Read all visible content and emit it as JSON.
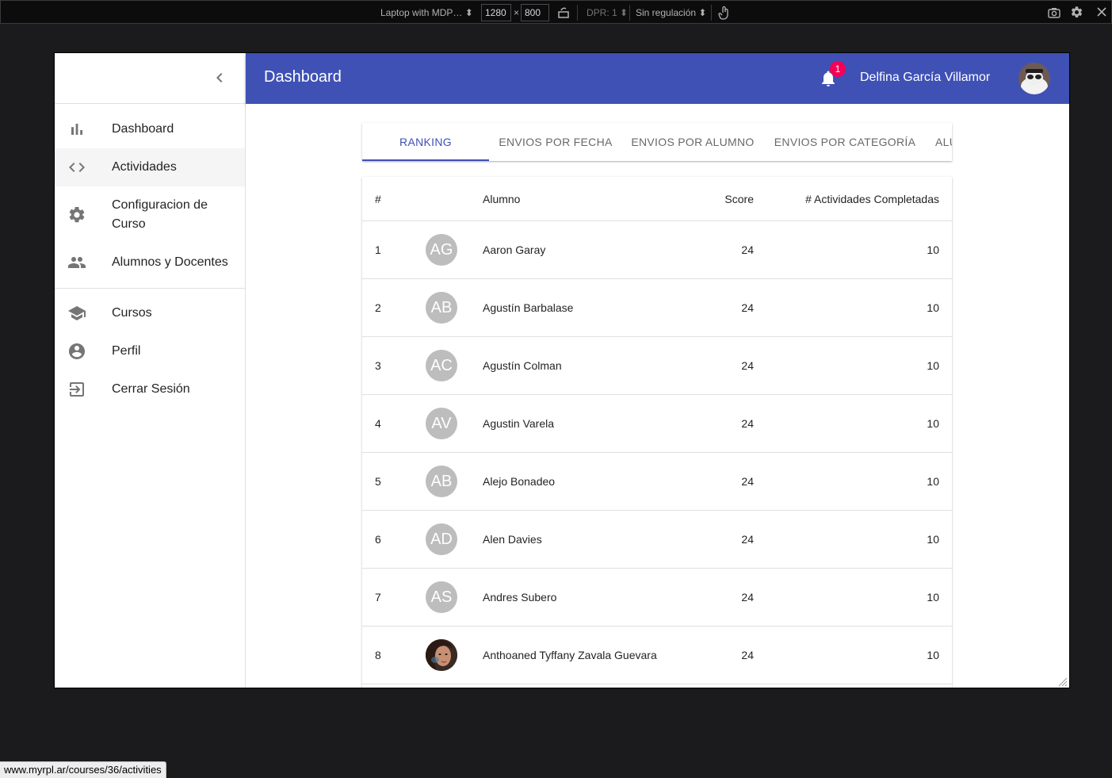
{
  "devtools": {
    "device": "Laptop with MDP…",
    "width": "1280",
    "times": "×",
    "height": "800",
    "dpr": "DPR: 1",
    "throttling": "Sin regulación"
  },
  "sidebar": {
    "primary": [
      {
        "label": "Dashboard",
        "icon": "bar-chart-icon",
        "active": false
      },
      {
        "label": "Actividades",
        "icon": "code-icon",
        "active": true
      },
      {
        "label": "Configuracion de Curso",
        "icon": "gear-icon",
        "active": false
      },
      {
        "label": "Alumnos y Docentes",
        "icon": "people-icon",
        "active": false
      }
    ],
    "secondary": [
      {
        "label": "Cursos",
        "icon": "graduation-cap-icon"
      },
      {
        "label": "Perfil",
        "icon": "account-circle-icon"
      },
      {
        "label": "Cerrar Sesión",
        "icon": "logout-icon"
      }
    ]
  },
  "appbar": {
    "title": "Dashboard",
    "notification_count": "1",
    "username": "Delfina García Villamor",
    "color": "#3f51b5"
  },
  "tabs": [
    {
      "label": "RANKING",
      "active": true
    },
    {
      "label": "ENVIOS POR FECHA"
    },
    {
      "label": "ENVIOS POR ALUMNO"
    },
    {
      "label": "ENVIOS POR CATEGORÍA"
    },
    {
      "label": "ALU"
    }
  ],
  "table": {
    "headers": {
      "num": "#",
      "name": "Alumno",
      "score": "Score",
      "activities": "# Actividades Completadas"
    },
    "rows": [
      {
        "num": "1",
        "initials": "AG",
        "name": "Aaron Garay",
        "score": "24",
        "activities": "10"
      },
      {
        "num": "2",
        "initials": "AB",
        "name": "Agustín Barbalase",
        "score": "24",
        "activities": "10"
      },
      {
        "num": "3",
        "initials": "AC",
        "name": "Agustín Colman",
        "score": "24",
        "activities": "10"
      },
      {
        "num": "4",
        "initials": "AV",
        "name": "Agustin Varela",
        "score": "24",
        "activities": "10"
      },
      {
        "num": "5",
        "initials": "AB",
        "name": "Alejo Bonadeo",
        "score": "24",
        "activities": "10"
      },
      {
        "num": "6",
        "initials": "AD",
        "name": "Alen Davies",
        "score": "24",
        "activities": "10"
      },
      {
        "num": "7",
        "initials": "AS",
        "name": "Andres Subero",
        "score": "24",
        "activities": "10"
      },
      {
        "num": "8",
        "initials": "",
        "name": "Anthoaned Tyffany Zavala Guevara",
        "score": "24",
        "activities": "10"
      }
    ]
  },
  "status_url": "www.myrpl.ar/courses/36/activities"
}
